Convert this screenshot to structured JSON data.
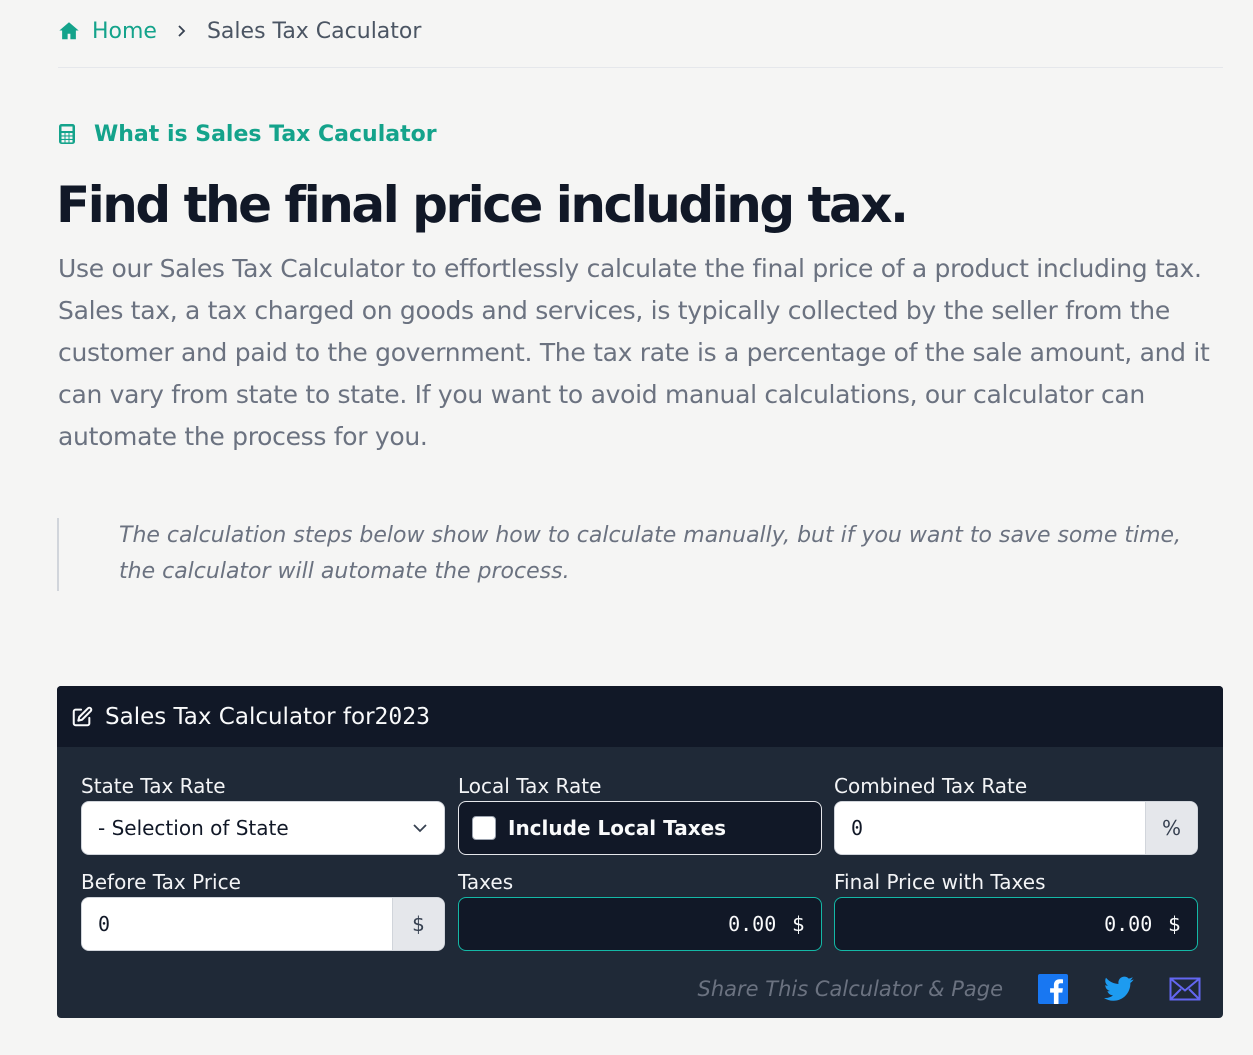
{
  "breadcrumb": {
    "home_label": "Home",
    "current_label": "Sales Tax Caculator"
  },
  "section_label": "What is Sales Tax Caculator",
  "page_title": "Find the final price including tax.",
  "intro": "Use our Sales Tax Calculator to effortlessly calculate the final price of a product including tax. Sales tax, a tax charged on goods and services, is typically collected by the seller from the customer and paid to the government. The tax rate is a percentage of the sale amount, and it can vary from state to state. If you want to avoid manual calculations, our calculator can automate the process for you.",
  "quote": "The calculation steps below show how to calculate manually, but if you want to save some time, the calculator will automate the process.",
  "calculator": {
    "title_prefix": "Sales Tax Calculator for ",
    "year": "2023",
    "state_tax_rate": {
      "label": "State Tax Rate",
      "selected": "- Selection of State"
    },
    "local_tax_rate": {
      "label": "Local Tax Rate",
      "checkbox_label": "Include Local Taxes",
      "checked": false
    },
    "combined_tax_rate": {
      "label": "Combined Tax Rate",
      "value": "0",
      "unit": "%"
    },
    "before_tax_price": {
      "label": "Before Tax Price",
      "value": "0",
      "unit": "$"
    },
    "taxes": {
      "label": "Taxes",
      "value": "0.00",
      "unit": "$"
    },
    "final_price": {
      "label": "Final Price with Taxes",
      "value": "0.00",
      "unit": "$"
    },
    "share": {
      "text": "Share This Calculator & Page",
      "icons": [
        "facebook-icon",
        "twitter-icon",
        "email-icon"
      ]
    }
  },
  "colors": {
    "accent": "#14a38b",
    "panel_bg": "#1f2937",
    "panel_header_bg": "#111827",
    "output_border": "#14b8a6",
    "facebook": "#1877f2",
    "twitter": "#1d9bf0",
    "email": "#6366f1"
  }
}
